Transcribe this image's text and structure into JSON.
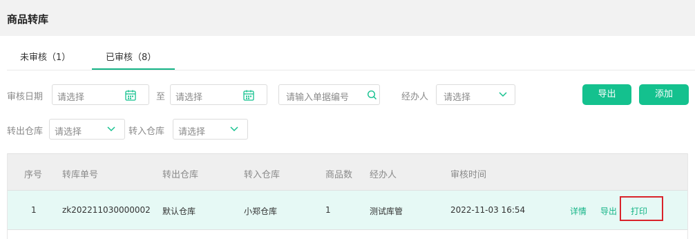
{
  "page": {
    "title": "商品转库"
  },
  "tabs": [
    {
      "label": "未审核（1）",
      "active": false
    },
    {
      "label": "已审核（8）",
      "active": true
    }
  ],
  "filters": {
    "audit_date_label": "审核日期",
    "date_start_placeholder": "请选择",
    "date_to": "至",
    "date_end_placeholder": "请选择",
    "doc_no_placeholder": "请输入单据编号",
    "handler_label": "经办人",
    "handler_placeholder": "请选择",
    "out_wh_label": "转出仓库",
    "out_wh_placeholder": "请选择",
    "in_wh_label": "转入仓库",
    "in_wh_placeholder": "请选择"
  },
  "actions": {
    "export": "导出",
    "add": "添加"
  },
  "table": {
    "headers": [
      "序号",
      "转库单号",
      "转出仓库",
      "转入仓库",
      "商品数",
      "经办人",
      "审核时间"
    ],
    "rows": [
      {
        "index": "1",
        "doc_no": "zk202211030000002",
        "out_wh": "默认仓库",
        "in_wh": "小郑仓库",
        "qty": "1",
        "handler": "测试库管",
        "audit_time": "2022-11-03 16:54",
        "ops": [
          "详情",
          "导出",
          "打印"
        ]
      }
    ]
  },
  "colors": {
    "accent": "#14c18e",
    "highlight": "#d9232a",
    "row_bg": "#e6f9f5"
  },
  "icons": {
    "calendar": "calendar-icon",
    "search": "search-icon",
    "dropdown": "chevron-down-icon"
  }
}
